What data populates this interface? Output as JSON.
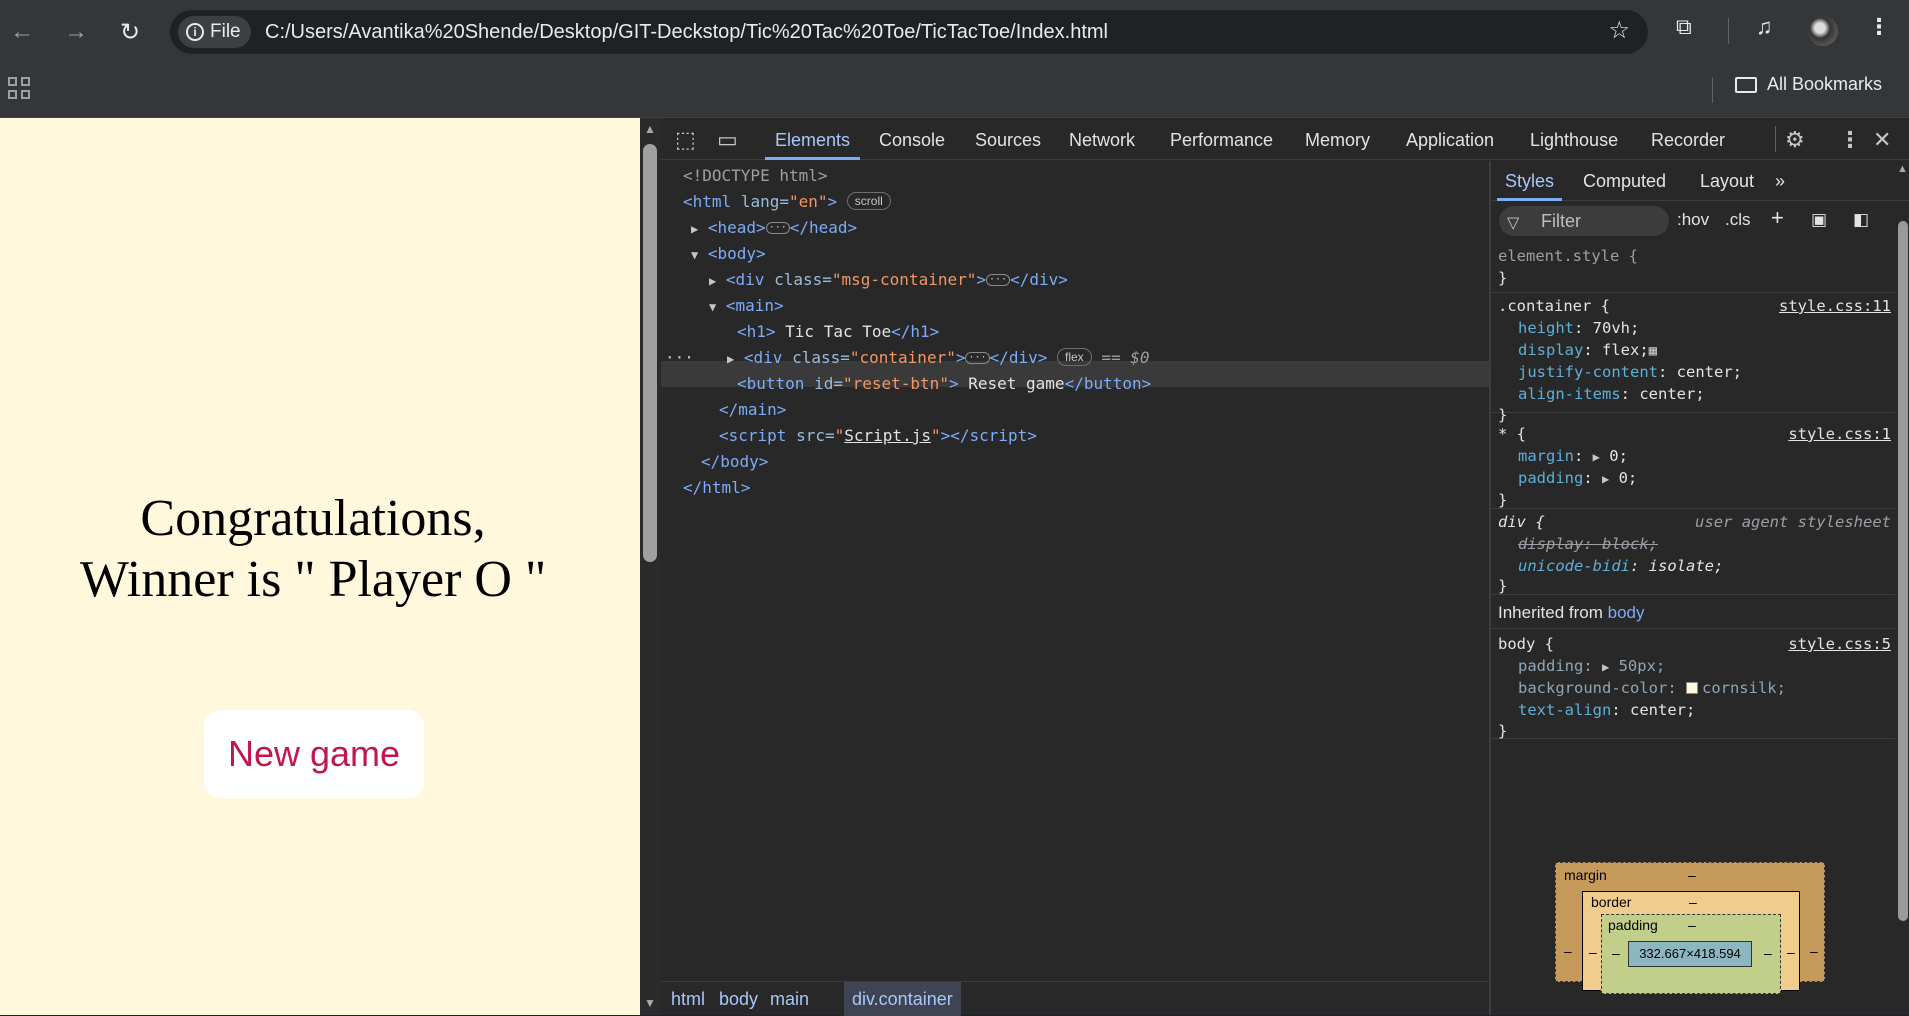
{
  "browser": {
    "site_chip": "File",
    "url": "C:/Users/Avantika%20Shende/Desktop/GIT-Deckstop/Tic%20Tac%20Toe/TicTacToe/Index.html",
    "all_bookmarks": "All Bookmarks"
  },
  "page": {
    "message_line1": "Congratulations,",
    "message_line2": "Winner is \" Player O \"",
    "new_game_label": "New game"
  },
  "devtools": {
    "tabs": [
      "Elements",
      "Console",
      "Sources",
      "Network",
      "Performance",
      "Memory",
      "Application",
      "Lighthouse",
      "Recorder"
    ],
    "active_tab": "Elements",
    "dom": {
      "doctype": "<!DOCTYPE html>",
      "html_open_tag": "html",
      "html_lang_attr": "lang",
      "html_lang_val": "\"en\"",
      "scroll_badge": "scroll",
      "head_tag": "head",
      "body_tag": "body",
      "div_tag": "div",
      "class_attr": "class",
      "msg_container_val": "\"msg-container\"",
      "main_tag": "main",
      "h1_text": " Tic Tac Toe",
      "container_val": "\"container\"",
      "flex_badge": "flex",
      "selected_marker": "== $0",
      "button_id_attr": "id",
      "button_id_val": "\"reset-btn\"",
      "button_text": " Reset game",
      "script_src_attr": "src",
      "script_src_val": "Script.js"
    },
    "breadcrumbs": [
      "html",
      "body",
      "main",
      "div.container"
    ],
    "styles": {
      "tabs": [
        "Styles",
        "Computed",
        "Layout"
      ],
      "filter_placeholder": "Filter",
      "hov": ":hov",
      "cls": ".cls",
      "element_style": "element.style {",
      "container_selector": ".container {",
      "container_source": "style.css:11",
      "container_props": [
        {
          "name": "height",
          "value": "70vh;"
        },
        {
          "name": "display",
          "value": "flex;"
        },
        {
          "name": "justify-content",
          "value": "center;"
        },
        {
          "name": "align-items",
          "value": "center;"
        }
      ],
      "universal_selector": "* {",
      "universal_source": "style.css:1",
      "universal_props": [
        {
          "name": "margin",
          "value": "0;"
        },
        {
          "name": "padding",
          "value": "0;"
        }
      ],
      "div_selector": "div {",
      "ua_label": "user agent stylesheet",
      "div_props": [
        {
          "name": "display",
          "value": "block;"
        },
        {
          "name": "unicode-bidi",
          "value": "isolate;"
        }
      ],
      "inherited_label": "Inherited from",
      "inherited_from": "body",
      "body_selector": "body {",
      "body_source": "style.css:5",
      "body_props": [
        {
          "name": "padding",
          "value": "50px;"
        },
        {
          "name": "background-color",
          "value": "cornsilk;"
        },
        {
          "name": "text-align",
          "value": "center;"
        }
      ],
      "close_brace": "}"
    },
    "box_model": {
      "margin_label": "margin",
      "border_label": "border",
      "padding_label": "padding",
      "dash": "–",
      "content_size": "332.667×418.594"
    }
  },
  "colors": {
    "page_background": "#fff8dc",
    "new_game_text": "#c2174d",
    "devtools_accent": "#7cacf8"
  }
}
